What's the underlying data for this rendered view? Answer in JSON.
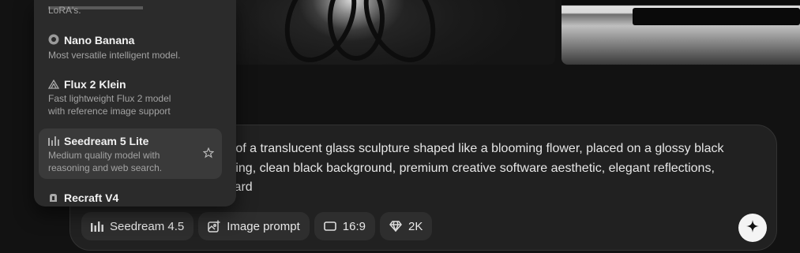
{
  "prompt": {
    "text": "h of a translucent glass sculpture shaped like a blooming flower, placed on a glossy black\nnting, clean black background, premium creative software aesthetic, elegant reflections,\nward"
  },
  "toolbar": {
    "model_label": "Seedream 4.5",
    "image_prompt_label": "Image prompt",
    "aspect_label": "16:9",
    "resolution_label": "2K"
  },
  "model_menu": {
    "cut_desc": "LoRA's.",
    "items": [
      {
        "name": "Nano Banana",
        "desc": "Most versatile intelligent model.",
        "icon": "nano-banana-icon"
      },
      {
        "name": "Flux 2 Klein",
        "desc": "Fast lightweight Flux 2 model\nwith reference image support",
        "icon": "flux-icon"
      },
      {
        "name": "Seedream 5 Lite",
        "desc": "Medium quality model with\nreasoning and web search.",
        "icon": "seedream-icon",
        "selected": true
      },
      {
        "name": "Recraft V4",
        "desc": "",
        "icon": "recraft-icon"
      }
    ]
  },
  "colors": {
    "background": "#121212",
    "panel": "#2b2b2b",
    "selected": "#3a3a3a",
    "chip": "#2e2e2e"
  }
}
